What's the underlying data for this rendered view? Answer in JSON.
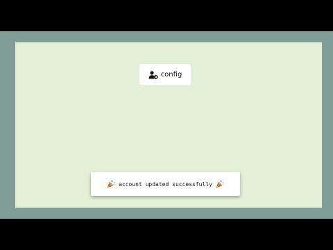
{
  "config_button": {
    "label": "config",
    "icon": "user-gear-icon"
  },
  "toast": {
    "message": "account updated successfully",
    "leading_icon": "party-popper-icon",
    "trailing_icon": "party-popper-icon"
  },
  "colors": {
    "frame": "#809d98",
    "stage": "#e3f0d7",
    "card": "#ffffff"
  }
}
